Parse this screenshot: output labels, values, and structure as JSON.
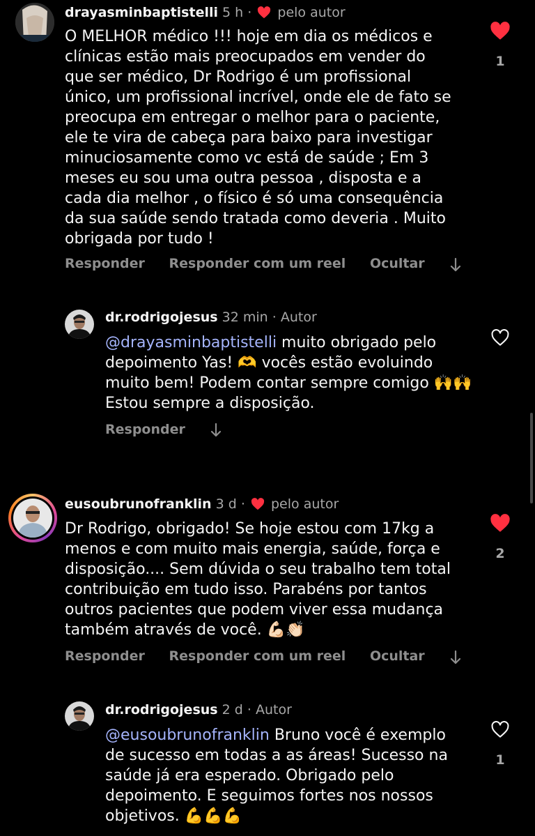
{
  "comments": [
    {
      "username": "drayasminbaptistelli",
      "time": "5 h",
      "liked_by_author": "pelo autor",
      "text": "O MELHOR médico !!! hoje em dia os médicos e clínicas estão mais preocupados em vender do que ser médico, Dr Rodrigo é um profissional único, um profissional incrível, onde ele de fato se preocupa em entregar o melhor para o paciente, ele te vira de cabeça para baixo para investigar minuciosamente como vc está de saúde ; Em 3 meses eu sou uma outra pessoa , disposta e a cada dia melhor , o físico é só uma consequência da sua saúde sendo tratada como deveria . Muito obrigada por tudo !",
      "like_count": "1",
      "liked": true,
      "actions": [
        "Responder",
        "Responder com um reel",
        "Ocultar"
      ],
      "reply": {
        "username": "dr.rodrigojesus",
        "time": "32 min",
        "badge": "Autor",
        "mention": "@drayasminbaptistelli",
        "text": " muito obrigado pelo depoimento Yas! 🫶 vocês estão evoluindo muito bem! Podem contar sempre comigo 🙌🙌 Estou sempre a disposição.",
        "actions": [
          "Responder"
        ]
      }
    },
    {
      "username": "eusoubrunofranklin",
      "time": "3 d",
      "liked_by_author": "pelo autor",
      "text": "Dr Rodrigo, obrigado! Se hoje estou com 17kg a menos e com muito mais energia, saúde, força e disposição.... Sem dúvida o seu trabalho tem total contribuição em tudo isso. Parabéns por tantos outros pacientes que podem viver essa mudança também através de você. 💪🏻👏🏻",
      "like_count": "2",
      "liked": true,
      "actions": [
        "Responder",
        "Responder com um reel",
        "Ocultar"
      ],
      "reply": {
        "username": "dr.rodrigojesus",
        "time": "2 d",
        "badge": "Autor",
        "mention": "@eusoubrunofranklin",
        "text": " Bruno você é exemplo de sucesso em todas a as áreas! Sucesso na saúde já era esperado. Obrigado pelo depoimento. E seguimos fortes nos nossos objetivos. 💪💪💪",
        "like_count": "1"
      }
    }
  ],
  "colors": {
    "heart_red": "#ff3040",
    "mention": "#a5b4fc",
    "background": "#000000"
  },
  "icons": [
    "heart-filled-icon",
    "heart-outline-icon",
    "arrow-down-icon"
  ]
}
